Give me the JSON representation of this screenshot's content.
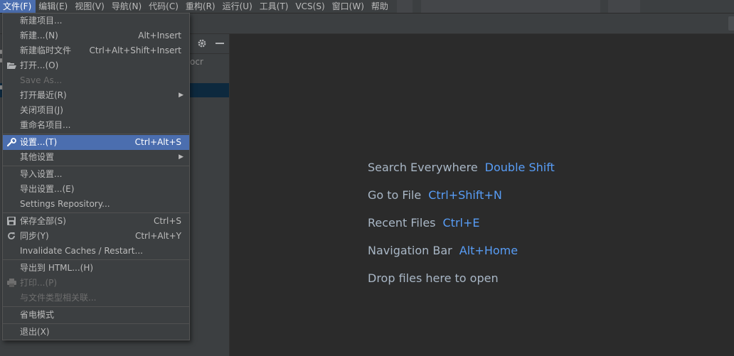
{
  "menubar": {
    "items": [
      "文件(F)",
      "编辑(E)",
      "视图(V)",
      "导航(N)",
      "代码(C)",
      "重构(R)",
      "运行(U)",
      "工具(T)",
      "VCS(S)",
      "窗口(W)",
      "帮助"
    ]
  },
  "project_panel": {
    "partial_text": "ocr"
  },
  "file_menu": {
    "groups": [
      [
        {
          "label": "新建项目...",
          "shortcut": "",
          "icon": "",
          "disabled": false,
          "submenu": false
        },
        {
          "label": "新建...(N)",
          "shortcut": "Alt+Insert",
          "icon": "",
          "disabled": false,
          "submenu": false
        },
        {
          "label": "新建临时文件",
          "shortcut": "Ctrl+Alt+Shift+Insert",
          "icon": "",
          "disabled": false,
          "submenu": false
        },
        {
          "label": "打开...(O)",
          "shortcut": "",
          "icon": "folder-open-icon",
          "disabled": false,
          "submenu": false
        },
        {
          "label": "Save As...",
          "shortcut": "",
          "icon": "",
          "disabled": true,
          "submenu": false
        },
        {
          "label": "打开最近(R)",
          "shortcut": "",
          "icon": "",
          "disabled": false,
          "submenu": true
        },
        {
          "label": "关闭项目(J)",
          "shortcut": "",
          "icon": "",
          "disabled": false,
          "submenu": false
        },
        {
          "label": "重命名项目...",
          "shortcut": "",
          "icon": "",
          "disabled": false,
          "submenu": false
        }
      ],
      [
        {
          "label": "设置...(T)",
          "shortcut": "Ctrl+Alt+S",
          "icon": "wrench-icon",
          "disabled": false,
          "submenu": false,
          "selected": true
        },
        {
          "label": "其他设置",
          "shortcut": "",
          "icon": "",
          "disabled": false,
          "submenu": true
        }
      ],
      [
        {
          "label": "导入设置...",
          "shortcut": "",
          "icon": "",
          "disabled": false,
          "submenu": false
        },
        {
          "label": "导出设置...(E)",
          "shortcut": "",
          "icon": "",
          "disabled": false,
          "submenu": false
        },
        {
          "label": "Settings Repository...",
          "shortcut": "",
          "icon": "",
          "disabled": false,
          "submenu": false
        }
      ],
      [
        {
          "label": "保存全部(S)",
          "shortcut": "Ctrl+S",
          "icon": "save-icon",
          "disabled": false,
          "submenu": false
        },
        {
          "label": "同步(Y)",
          "shortcut": "Ctrl+Alt+Y",
          "icon": "sync-icon",
          "disabled": false,
          "submenu": false
        },
        {
          "label": "Invalidate Caches / Restart...",
          "shortcut": "",
          "icon": "",
          "disabled": false,
          "submenu": false
        }
      ],
      [
        {
          "label": "导出到 HTML...(H)",
          "shortcut": "",
          "icon": "",
          "disabled": false,
          "submenu": false
        },
        {
          "label": "打印...(P)",
          "shortcut": "",
          "icon": "print-icon",
          "disabled": true,
          "submenu": false
        },
        {
          "label": "与文件类型相关联...",
          "shortcut": "",
          "icon": "",
          "disabled": true,
          "submenu": false
        }
      ],
      [
        {
          "label": "省电模式",
          "shortcut": "",
          "icon": "",
          "disabled": false,
          "submenu": false
        }
      ],
      [
        {
          "label": "退出(X)",
          "shortcut": "",
          "icon": "",
          "disabled": false,
          "submenu": false
        }
      ]
    ]
  },
  "editor_hints": [
    {
      "label": "Search Everywhere",
      "key": "Double Shift"
    },
    {
      "label": "Go to File",
      "key": "Ctrl+Shift+N"
    },
    {
      "label": "Recent Files",
      "key": "Ctrl+E"
    },
    {
      "label": "Navigation Bar",
      "key": "Alt+Home"
    },
    {
      "label": "Drop files here to open",
      "key": ""
    }
  ],
  "colors": {
    "accent": "#4b6eaf",
    "hint_key": "#589df6",
    "panel_bg": "#3c3f41",
    "editor_bg": "#2b2b2b"
  }
}
